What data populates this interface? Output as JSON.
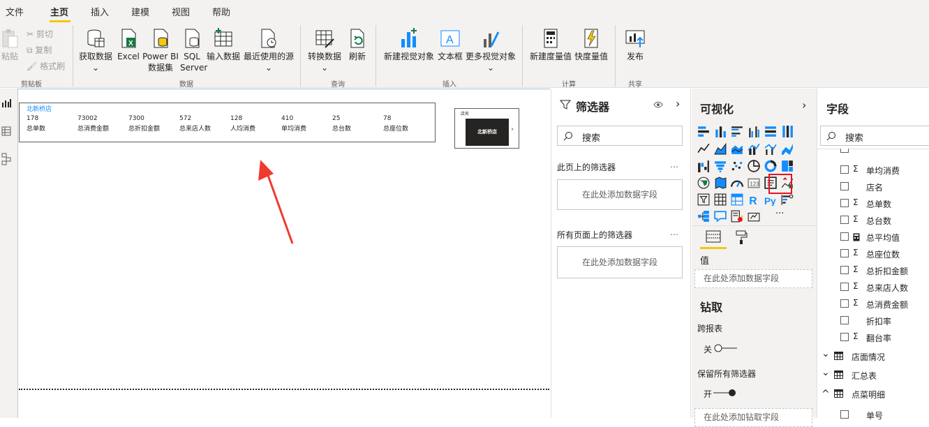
{
  "menu": [
    "文件",
    "主页",
    "插入",
    "建模",
    "视图",
    "帮助"
  ],
  "ribbon": {
    "clipboard": {
      "paste": "粘贴",
      "cut": "剪切",
      "copy": "复制",
      "format_painter": "格式刷",
      "group": "剪贴板"
    },
    "data": {
      "get_data": "获取数据",
      "excel": "Excel",
      "pbi_1": "Power BI",
      "pbi_2": "数据集",
      "sql_1": "SQL",
      "sql_2": "Server",
      "enter_data": "输入数据",
      "recent": "最近使用的源",
      "group": "数据"
    },
    "query": {
      "transform": "转换数据",
      "refresh": "刷新",
      "group": "查询"
    },
    "insert": {
      "new_visual": "新建视觉对象",
      "textbox": "文本框",
      "more_visuals": "更多视觉对象",
      "group": "插入"
    },
    "calc": {
      "new_measure": "新建度量值",
      "quick_measure": "快度量值",
      "group": "计算"
    },
    "share": {
      "publish": "发布",
      "group": "共享"
    }
  },
  "canvas": {
    "table_header": "北新桥店",
    "metrics": [
      {
        "value": "178",
        "label": "总单数"
      },
      {
        "value": "73002",
        "label": "总消费金额"
      },
      {
        "value": "7300",
        "label": "总折扣金额"
      },
      {
        "value": "572",
        "label": "总来店人数"
      },
      {
        "value": "128",
        "label": "人均消费"
      },
      {
        "value": "410",
        "label": "单均消费"
      },
      {
        "value": "25",
        "label": "总台数"
      },
      {
        "value": "78",
        "label": "总座位数"
      }
    ],
    "slicer_title": "店名",
    "slicer_value": "北新桥店"
  },
  "filters": {
    "title": "筛选器",
    "search_placeholder": "搜索",
    "page_filters": "此页上的筛选器",
    "all_pages_filters": "所有页面上的筛选器",
    "add_field": "在此处添加数据字段",
    "more": "…"
  },
  "viz": {
    "title": "可视化",
    "values_label": "值",
    "add_field": "在此处添加数据字段",
    "drillthrough": "钻取",
    "cross_report": "跨报表",
    "cross_report_state": "关",
    "keep_filters": "保留所有筛选器",
    "keep_filters_state": "开",
    "add_drill_field": "在此处添加钻取字段",
    "more": "···"
  },
  "fields": {
    "title": "字段",
    "search_placeholder": "搜索",
    "items": [
      {
        "name": "单均消费",
        "icon": "sigma-icon"
      },
      {
        "name": "店名",
        "icon": ""
      },
      {
        "name": "总单数",
        "icon": "sigma-icon"
      },
      {
        "name": "总台数",
        "icon": "sigma-icon"
      },
      {
        "name": "总平均值",
        "icon": "calculator-icon"
      },
      {
        "name": "总座位数",
        "icon": "sigma-icon"
      },
      {
        "name": "总折扣金额",
        "icon": "sigma-icon"
      },
      {
        "name": "总来店人数",
        "icon": "sigma-icon"
      },
      {
        "name": "总消费金额",
        "icon": "sigma-icon"
      },
      {
        "name": "折扣率",
        "icon": ""
      },
      {
        "name": "翻台率",
        "icon": "sigma-icon"
      }
    ],
    "tables": [
      "店面情况",
      "汇总表",
      "点菜明细"
    ],
    "sub_item": "单号"
  },
  "colors": {
    "accent": "#f2c811",
    "highlight": "#e81123",
    "arrow": "#f03a2e",
    "selected": "#118dff"
  }
}
